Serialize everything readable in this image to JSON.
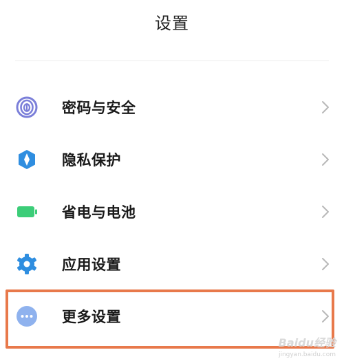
{
  "header": {
    "title": "设置"
  },
  "items": [
    {
      "label": "密码与安全",
      "icon": "fingerprint-icon",
      "color": "#7b7fd9"
    },
    {
      "label": "隐私保护",
      "icon": "shield-icon",
      "color": "#2f8ee0"
    },
    {
      "label": "省电与电池",
      "icon": "battery-icon",
      "color": "#3ccd78"
    },
    {
      "label": "应用设置",
      "icon": "gear-icon",
      "color": "#2f8ee0"
    },
    {
      "label": "更多设置",
      "icon": "more-dots-icon",
      "color": "#8fb2ee"
    }
  ],
  "highlight": {
    "color": "#e8794b"
  },
  "watermark": {
    "brand": "Baidu经验",
    "domain": "jingyan.baidu.com"
  }
}
